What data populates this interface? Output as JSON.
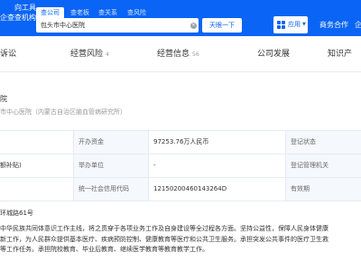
{
  "header": {
    "logo_lines": [
      "向工具",
      "企查查机构"
    ],
    "search_tabs": [
      "查公司",
      "查老板",
      "查关系",
      "查风险"
    ],
    "search_value": "包头市中心医院",
    "clear_icon": "✕",
    "search_button": "天眼一下",
    "apps_label": "应用",
    "apps_caret": "▼",
    "links": [
      "商务合作",
      "企"
    ]
  },
  "nav_tabs": [
    {
      "label": "诉讼",
      "count": ""
    },
    {
      "label": "经营风险",
      "count": "4"
    },
    {
      "label": "经营信息",
      "count": "56"
    },
    {
      "label": "公司发展",
      "count": ""
    },
    {
      "label": "知识产",
      "count": ""
    }
  ],
  "org": {
    "title": "院",
    "former_name": "市中心医院（内蒙古自治区脑血管病研究所）"
  },
  "info_table": [
    {
      "col0": "",
      "label1": "开办资金",
      "value1": "97253.76万人民币",
      "label2": "登记状态"
    },
    {
      "col0": "额补贴)",
      "label1": "举办单位",
      "value1": "-",
      "label2": "登记管理机关"
    },
    {
      "col0": "",
      "label1": "统一社会信用代码",
      "value1": "12150200460143264D",
      "label2": "有效期"
    }
  ],
  "address": "环城路61号",
  "scope_lines": [
    "中华民族共同体意识工作主线，将之贯穿于各项业务工作及自身建设等全过程各方面。坚持公益性，保障人民身体健康",
    "新工作，为人民群众提供基本医疗、疾病预防控制、健康教育等医疗和公共卫生服务。承担突发公共事件的医疗卫生救",
    "等工作任务。承担院校教育、毕业后教育、继续医学教育等教育教学工作。"
  ]
}
